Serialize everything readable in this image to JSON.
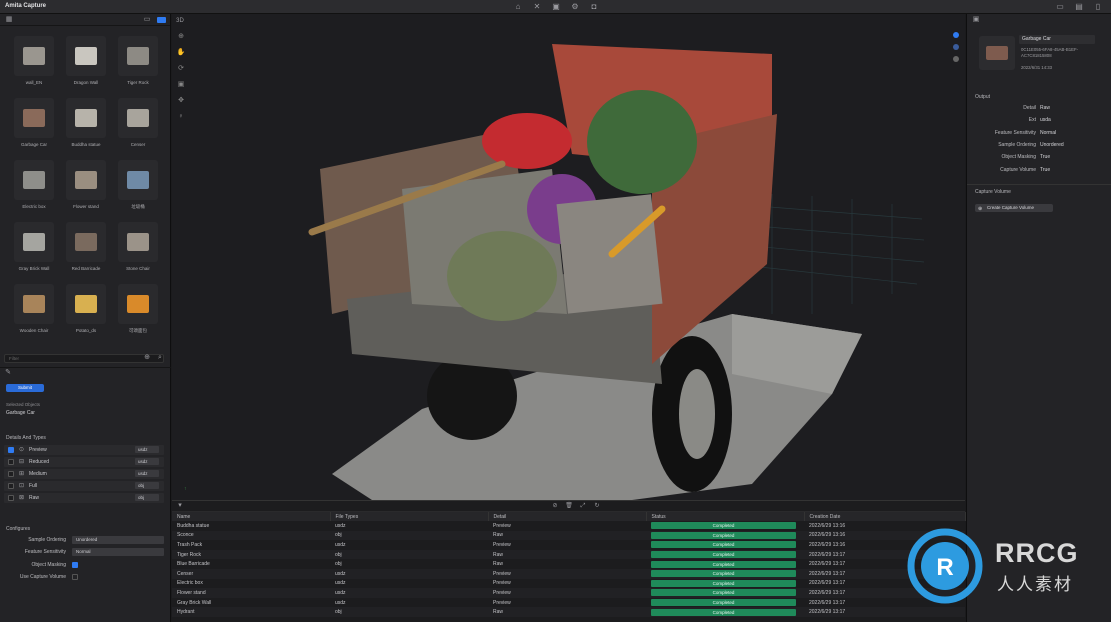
{
  "app": {
    "title": "Amita Capture"
  },
  "left_panel": {
    "thumbnails": [
      {
        "label": "wall_EN"
      },
      {
        "label": "Dragon Wall"
      },
      {
        "label": "Tiger Rock"
      },
      {
        "label": "Garbage Car"
      },
      {
        "label": "Buddha statue"
      },
      {
        "label": "Censer"
      },
      {
        "label": "Electric box"
      },
      {
        "label": "Flower stand"
      },
      {
        "label": "垃圾桶"
      },
      {
        "label": "Gray Brick Wall"
      },
      {
        "label": "Red Barricade"
      },
      {
        "label": "Stone Chair"
      },
      {
        "label": "Wooden Chair"
      },
      {
        "label": "Potato_ds"
      },
      {
        "label": "可颂面包"
      }
    ],
    "filter_placeholder": "Filter",
    "submit_label": "Submit",
    "selected_objects_label": "Selected Objects",
    "selected_object": "Garbage Car",
    "details_title": "Details And Types",
    "details": [
      {
        "name": "Preview",
        "format": "usdz",
        "checked": true
      },
      {
        "name": "Reduced",
        "format": "usdz",
        "checked": false
      },
      {
        "name": "Medium",
        "format": "usdz",
        "checked": false
      },
      {
        "name": "Full",
        "format": "obj",
        "checked": false
      },
      {
        "name": "Raw",
        "format": "obj",
        "checked": false
      }
    ],
    "configures_title": "Configures",
    "config": {
      "sample_ordering_label": "Sample Ordering",
      "sample_ordering_value": "Unordered",
      "feature_sensitivity_label": "Feature Sensitivity",
      "feature_sensitivity_value": "Normal",
      "object_masking_label": "Object Masking",
      "use_capture_volume_label": "Use Capture Volume"
    }
  },
  "right_panel": {
    "name": "Garbage Car",
    "id": "0C11E055-6FA8-45AB-B1EF-AC7C81815808",
    "date": "2022/6/31 14:33",
    "output_title": "Output",
    "output": [
      {
        "k": "Detail",
        "v": "Raw"
      },
      {
        "k": "Ext",
        "v": "usda"
      },
      {
        "k": "Feature Sensitivity",
        "v": "Normal"
      },
      {
        "k": "Sample Ordering",
        "v": "Unordered"
      },
      {
        "k": "Object Masking",
        "v": "True"
      },
      {
        "k": "Capture Volume",
        "v": "True"
      }
    ],
    "capture_volume_title": "Capture Volume",
    "create_capture_volume_label": "Create Capture Volume"
  },
  "table": {
    "columns": [
      "Name",
      "File Types",
      "Detail",
      "Status",
      "Creation Date"
    ],
    "rows": [
      [
        "Buddha statue",
        "usdz",
        "Preview",
        "Completed",
        "2022/6/29 13:16"
      ],
      [
        "Sconce",
        "obj",
        "Raw",
        "Completed",
        "2022/6/29 13:16"
      ],
      [
        "Trash Pack",
        "usdz",
        "Preview",
        "Completed",
        "2022/6/29 13:16"
      ],
      [
        "Tiger Rock",
        "obj",
        "Raw",
        "Completed",
        "2022/6/29 13:17"
      ],
      [
        "Blue Barricade",
        "obj",
        "Raw",
        "Completed",
        "2022/6/29 13:17"
      ],
      [
        "Censer",
        "usdz",
        "Preview",
        "Completed",
        "2022/6/29 13:17"
      ],
      [
        "Electric box",
        "usdz",
        "Preview",
        "Completed",
        "2022/6/29 13:17"
      ],
      [
        "Flower stand",
        "usdz",
        "Preview",
        "Completed",
        "2022/6/29 13:17"
      ],
      [
        "Gray Brick Wall",
        "usdz",
        "Preview",
        "Completed",
        "2022/6/29 13:17"
      ],
      [
        "Hydrant",
        "obj",
        "Raw",
        "Completed",
        "2022/6/29 13:17"
      ]
    ]
  },
  "watermark": {
    "brand": "RRCG",
    "sub": "人人素材"
  },
  "colors": {
    "accent": "#2f7bf2",
    "status_green": "#1f8a5a"
  }
}
